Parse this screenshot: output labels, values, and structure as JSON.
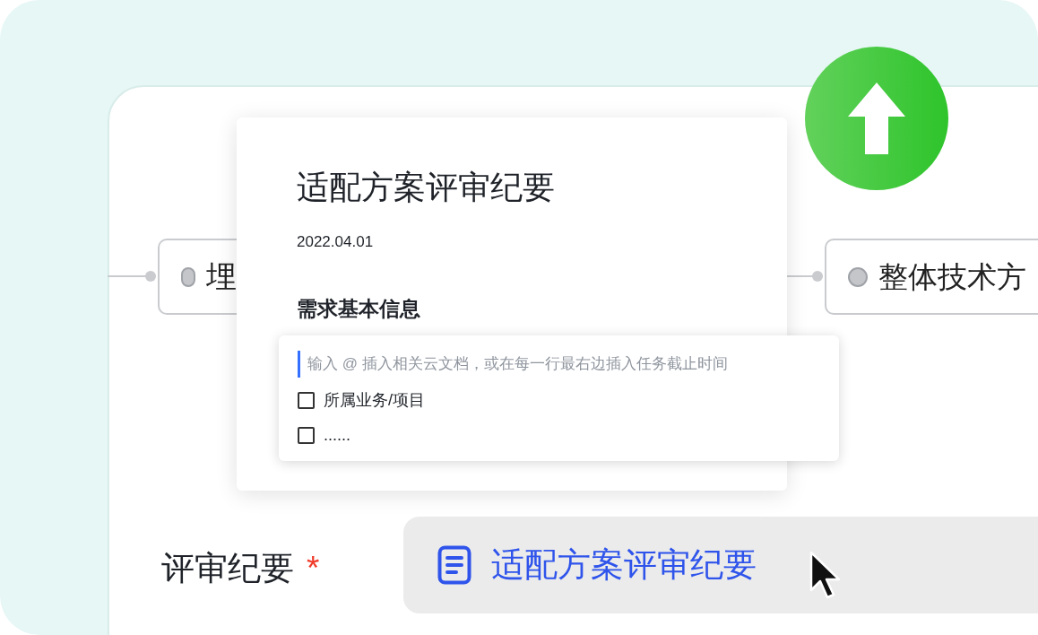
{
  "mindmap": {
    "nodes": [
      {
        "label": "埋"
      },
      {
        "label": "整体技术方"
      }
    ]
  },
  "document": {
    "title": "适配方案评审纪要",
    "date": "2022.04.01",
    "section": "需求基本信息",
    "editor": {
      "placeholder": "输入 @ 插入相关云文档，或在每一行最右边插入任务截止时间",
      "items": [
        {
          "label": "所属业务/项目",
          "checked": false
        },
        {
          "label": "......",
          "checked": false
        }
      ]
    }
  },
  "field": {
    "label": "评审纪要",
    "required_mark": "*",
    "value": "适配方案评审纪要"
  }
}
